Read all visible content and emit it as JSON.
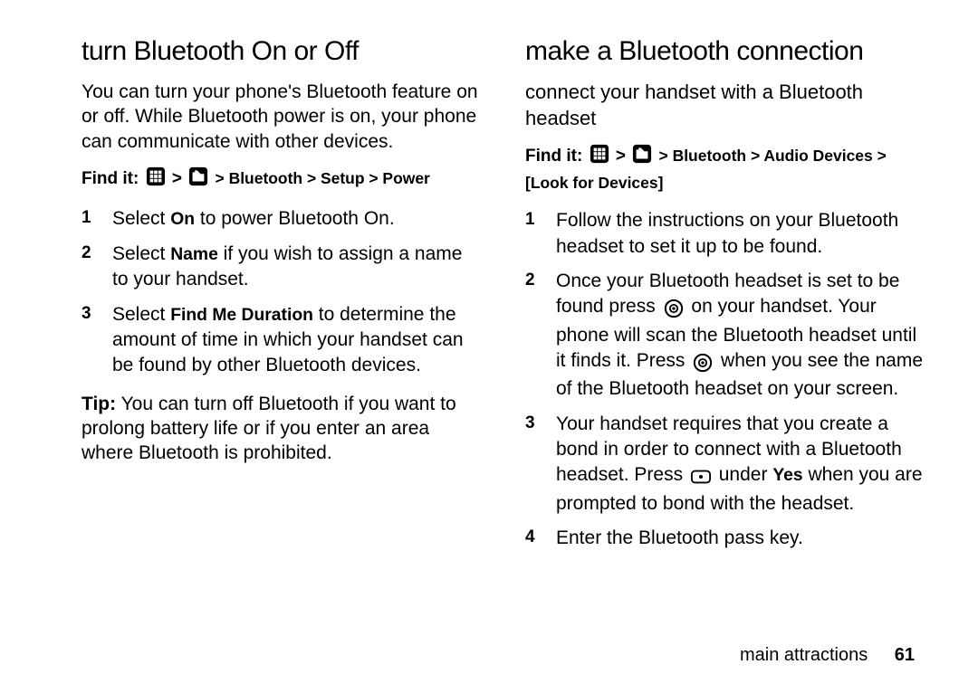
{
  "left": {
    "heading": "turn Bluetooth On or Off",
    "intro": "You can turn your phone's Bluetooth feature on or off. While Bluetooth power is on, your phone can communicate with other devices.",
    "findit": {
      "label": "Find it:",
      "path_after_icons": " > Bluetooth > Setup > Power"
    },
    "steps": {
      "s1_a": "Select ",
      "s1_b": "On",
      "s1_c": " to power Bluetooth On.",
      "s2_a": "Select ",
      "s2_b": "Name",
      "s2_c": " if you wish to assign a name to your handset.",
      "s3_a": "Select ",
      "s3_b": "Find Me Duration",
      "s3_c": " to determine the amount of time in which your handset can be found by other Bluetooth devices."
    },
    "tip": {
      "label": "Tip:",
      "text": " You can turn off Bluetooth if you want to prolong battery life or if you enter an area where Bluetooth is prohibited."
    }
  },
  "right": {
    "heading": "make a Bluetooth connection",
    "subheading": "connect your handset with a Bluetooth headset",
    "findit": {
      "label": "Find it:",
      "path_after_icons": " > Bluetooth > Audio Devices > [Look for Devices]"
    },
    "steps": {
      "s1": "Follow the instructions on your Bluetooth headset to set it up to be found.",
      "s2_a": "Once your Bluetooth headset is set to be found press ",
      "s2_b": " on your handset. Your phone will scan the Bluetooth headset until it finds it. Press ",
      "s2_c": " when you see the name of the Bluetooth headset on your screen.",
      "s3_a": "Your handset requires that you create a bond in order to connect with a Bluetooth headset. Press ",
      "s3_b": " under ",
      "s3_c": "Yes",
      "s3_d": " when you are prompted to bond with the headset.",
      "s4": "Enter the Bluetooth pass key."
    }
  },
  "footer": {
    "section": "main attractions",
    "page": "61"
  }
}
